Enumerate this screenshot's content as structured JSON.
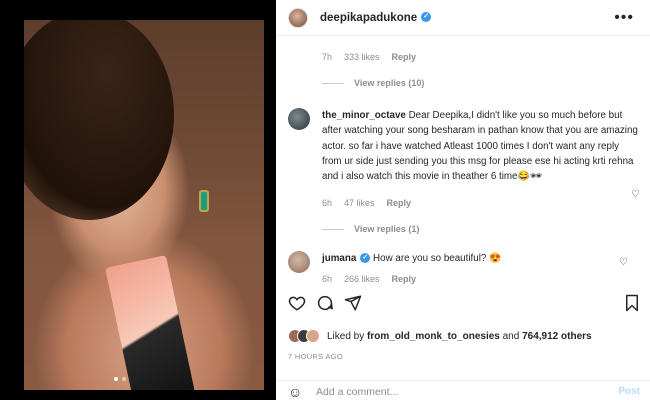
{
  "header": {
    "username": "deepikapadukone",
    "verified_mark": "✓",
    "more_icon": "more-horizontal-icon"
  },
  "top_comment": {
    "time": "7h",
    "likes": "333 likes",
    "reply": "Reply",
    "view_replies": "View replies (10)"
  },
  "comments": [
    {
      "username": "the_minor_octave",
      "text": "Dear Deepika,I didn't like you so much before but after watching your song besharam in pathan know that you are amazing actor. so far i have watched Atleast 1000 times I don't want any reply from ur side just sending you this msg for please ese hi acting krti rehna and i also watch this movie in theather 6 time😂🕶",
      "time": "6h",
      "likes": "47 likes",
      "reply": "Reply",
      "view_replies": "View replies (1)"
    },
    {
      "username": "jumana",
      "verified_mark": "✓",
      "text": "How are you so beautiful? 😍",
      "time": "6h",
      "likes": "266 likes",
      "reply": "Reply"
    }
  ],
  "actions": {
    "like_icon": "heart-icon",
    "comment_icon": "comment-icon",
    "share_icon": "send-icon",
    "save_icon": "bookmark-icon"
  },
  "likes": {
    "prefix": "Liked by",
    "user": "from_old_monk_to_onesies",
    "conj": "and",
    "others": "764,912 others"
  },
  "time_ago": "7 HOURS AGO",
  "add_comment": {
    "placeholder": "Add a comment...",
    "post_label": "Post"
  },
  "colors": {
    "verified": "#3897f0",
    "muted": "#8e8e8e",
    "post_disabled": "#b2dffc"
  }
}
